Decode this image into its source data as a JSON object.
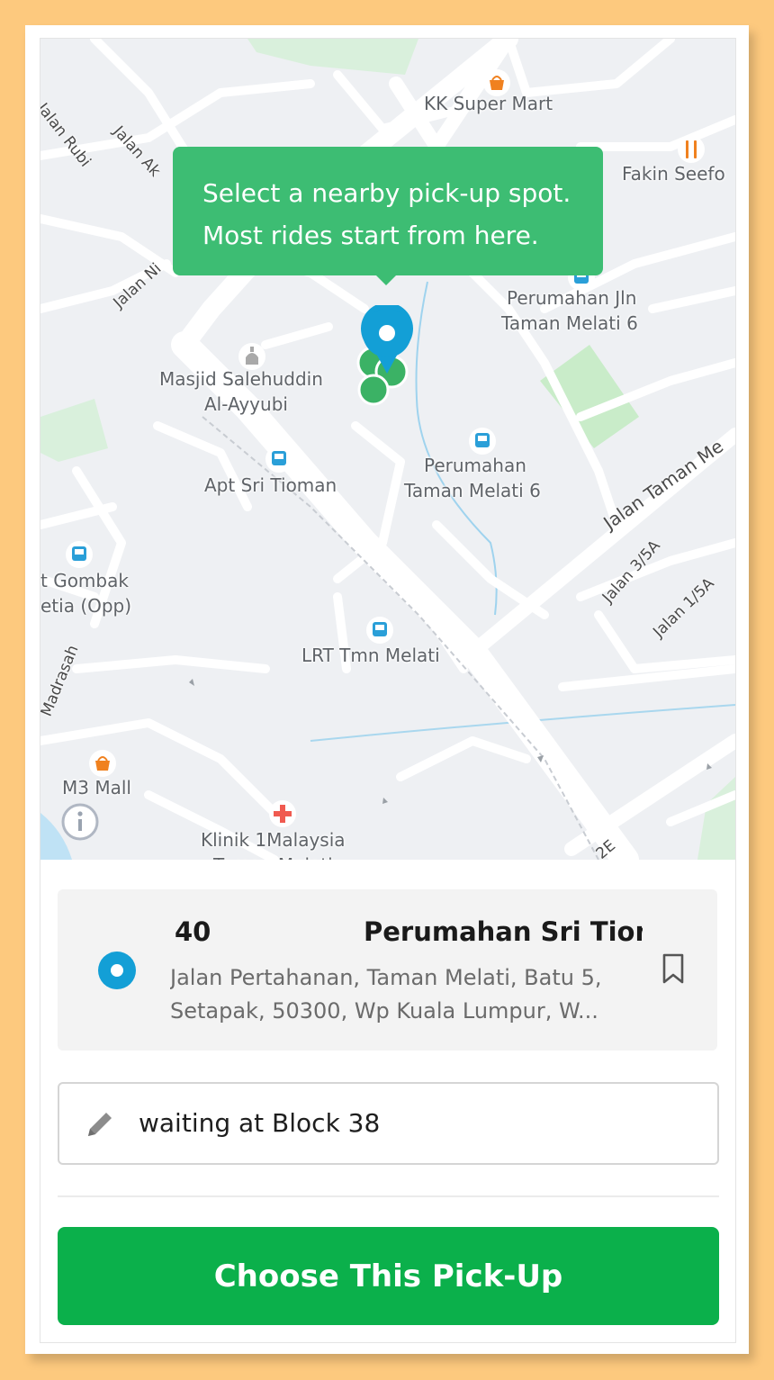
{
  "map": {
    "tooltip": {
      "line1": "Select a nearby pick-up spot.",
      "line2": "Most rides start from here."
    },
    "pois": {
      "kk_super_mart": "KK Super Mart",
      "fakin_seefo": "Fakin Seefo",
      "perumahan_jln_1": "Perumahan Jln",
      "perumahan_jln_2": "Taman Melati 6",
      "masjid_1": "Masjid Salehuddin",
      "masjid_2": "Al-Ayyubi",
      "apt_sri_tioman": "Apt Sri Tioman",
      "perumahan_tm_1": "Perumahan",
      "perumahan_tm_2": "Taman Melati 6",
      "gombak_1": "t Gombak",
      "gombak_2": "etia (Opp)",
      "lrt_tmn_melati": "LRT Tmn Melati",
      "m3_mall": "M3 Mall",
      "klinik": "Klinik 1Malaysia",
      "klinik_cut": "Taman Melati"
    },
    "roads": {
      "jalan_rubi": "Jalan Rubi",
      "jalan_ak": "Jalan Ak",
      "jalan_ni": "Jalan Ni",
      "jalan_taman_me": "Jalan Taman Me",
      "jalan_3_5a": "Jalan 3/5A",
      "jalan_1_5a": "Jalan 1/5A",
      "madrasah": "Madrasah",
      "road_code": "2E"
    }
  },
  "pickup": {
    "number": "40",
    "name": "Perumahan Sri Tion",
    "address_line1": "Jalan Pertahanan, Taman Melati, Batu 5,",
    "address_line2": "Setapak, 50300, Wp Kuala Lumpur, W..."
  },
  "note": {
    "value": "waiting at Block 38"
  },
  "cta": {
    "label": "Choose This Pick-Up"
  },
  "colors": {
    "page_background": "#fdc97e",
    "tooltip_green": "#3dbd73",
    "cta_green": "#0bb04b",
    "pin_blue": "#139fd6",
    "poi_bus_blue": "#2a9fd8",
    "poi_shop_orange": "#f0811f",
    "poi_clinic_red": "#f05a50"
  },
  "icons": {
    "pin": "location-pin-icon",
    "bookmark": "bookmark-icon",
    "pencil": "pencil-icon",
    "info": "info-icon",
    "bus": "bus-stop-icon",
    "shop": "shopping-basket-icon",
    "restaurant": "restaurant-icon",
    "mosque": "mosque-icon",
    "clinic": "clinic-cross-icon"
  }
}
